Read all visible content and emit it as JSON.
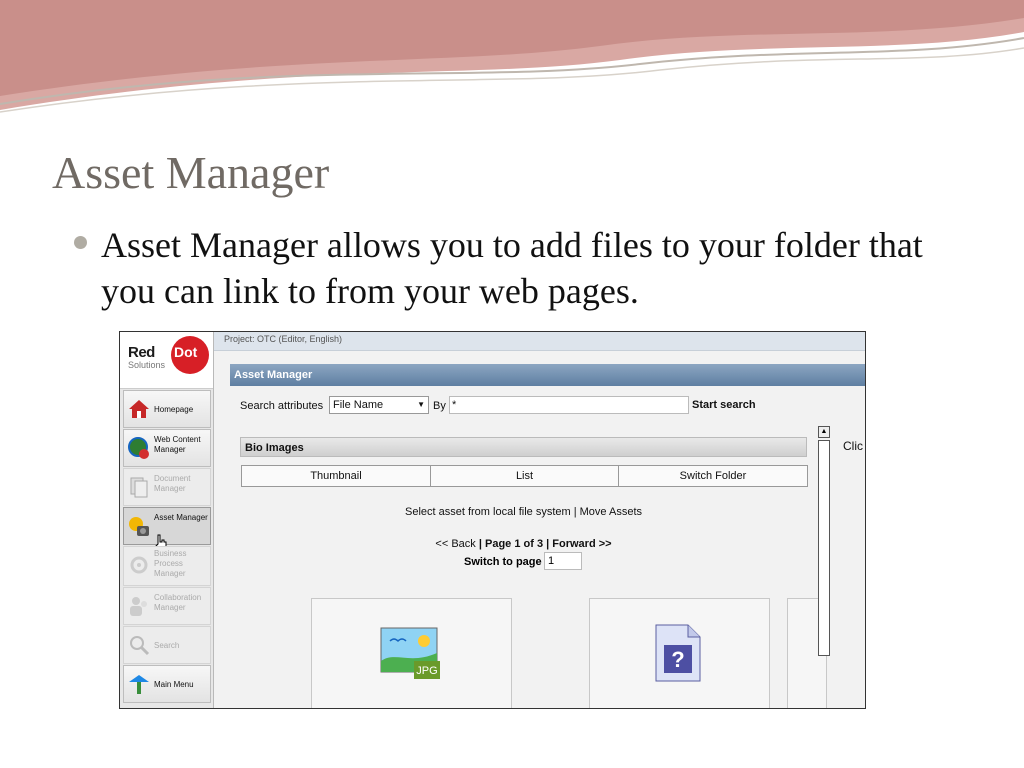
{
  "slide": {
    "title": "Asset Manager",
    "bullet": "Asset Manager allows you to add files to your folder that you can link to from your web pages."
  },
  "app": {
    "project_bar": "Project: OTC (Editor, English)",
    "panel_title": "Asset Manager",
    "logo": {
      "word": "Red",
      "dot": "Dot",
      "sub": "Solutions"
    },
    "nav": [
      {
        "label": "Homepage",
        "state": "normal",
        "icon": "homepage-icon"
      },
      {
        "label": "Web Content Manager",
        "state": "normal",
        "icon": "web-content-icon"
      },
      {
        "label": "Document Manager",
        "state": "disabled",
        "icon": "document-icon"
      },
      {
        "label": "Asset Manager",
        "state": "active",
        "icon": "asset-manager-icon"
      },
      {
        "label": "Business Process Manager",
        "state": "disabled",
        "icon": "process-gear-icon"
      },
      {
        "label": "Collaboration Manager",
        "state": "disabled",
        "icon": "collaboration-icon"
      },
      {
        "label": "Search",
        "state": "disabled",
        "icon": "search-icon"
      },
      {
        "label": "Main Menu",
        "state": "normal",
        "icon": "main-menu-icon"
      }
    ],
    "search": {
      "label": "Search attributes",
      "attribute_value": "File Name",
      "by_label": "By",
      "query_value": "*",
      "button": "Start search"
    },
    "folder": {
      "name": "Bio Images"
    },
    "tabs": [
      "Thumbnail",
      "List",
      "Switch Folder"
    ],
    "actions": {
      "select_local": "Select asset from local file system",
      "separator": "|",
      "move_assets": "Move Assets"
    },
    "pager": {
      "back": "<< Back",
      "sep": "|",
      "page_info": "Page 1 of 3",
      "forward": "Forward >>",
      "switch_label": "Switch to page",
      "switch_value": "1"
    },
    "assets": [
      {
        "type": "jpg-image",
        "badge": "JPG"
      },
      {
        "type": "unknown-file",
        "badge": "?"
      }
    ],
    "side_text": "Clic",
    "colors": {
      "brand_red": "#d71f26",
      "title_bar": "#6b88a8",
      "accent_text": "#706a64"
    }
  }
}
